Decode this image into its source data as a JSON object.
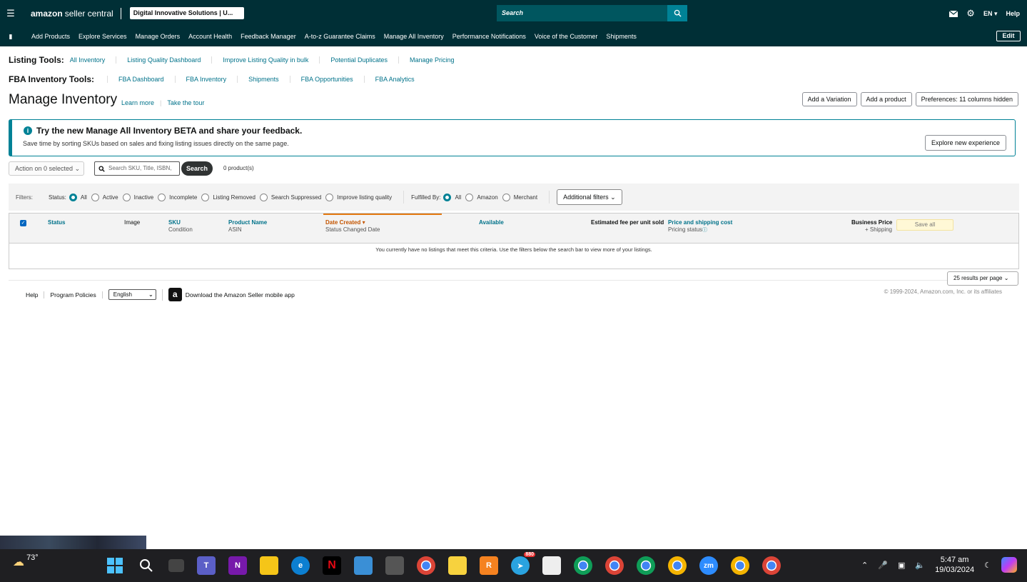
{
  "header": {
    "logo_text": "amazon",
    "logo_sub": "seller central",
    "account": "Digital Innovative Solutions | U...",
    "search_placeholder": "Search",
    "language": "EN",
    "help": "Help"
  },
  "nav": {
    "items": [
      "Add Products",
      "Explore Services",
      "Manage Orders",
      "Account Health",
      "Feedback Manager",
      "A-to-z Guarantee Claims",
      "Manage All Inventory",
      "Performance Notifications",
      "Voice of the Customer",
      "Shipments"
    ],
    "edit": "Edit"
  },
  "listing_tools": {
    "title": "Listing Tools:",
    "links": [
      "All Inventory",
      "Listing Quality Dashboard",
      "Improve Listing Quality in bulk",
      "Potential Duplicates",
      "Manage Pricing"
    ]
  },
  "fba_tools": {
    "title": "FBA Inventory Tools:",
    "links": [
      "FBA Dashboard",
      "FBA Inventory",
      "Shipments",
      "FBA Opportunities",
      "FBA Analytics"
    ]
  },
  "page": {
    "title": "Manage Inventory",
    "learn_more": "Learn more",
    "take_tour": "Take the tour",
    "add_variation": "Add a Variation",
    "add_product": "Add a product",
    "preferences": "Preferences: 11 columns hidden"
  },
  "banner": {
    "title": "Try the new Manage All Inventory BETA and share your feedback.",
    "body": "Save time by sorting SKUs based on sales and fixing listing issues directly on the same page.",
    "button": "Explore new experience"
  },
  "toolbar": {
    "action": "Action on 0 selected",
    "search_placeholder": "Search SKU, Title, ISBN,",
    "search_button": "Search",
    "count": "0 product(s)"
  },
  "filters": {
    "label": "Filters:",
    "status_label": "Status:",
    "status_options": [
      "All",
      "Active",
      "Inactive",
      "Incomplete",
      "Listing Removed",
      "Search Suppressed",
      "Improve listing quality"
    ],
    "fulfilled_label": "Fulfilled By:",
    "fulfilled_options": [
      "All",
      "Amazon",
      "Merchant"
    ],
    "additional": "Additional filters"
  },
  "table": {
    "col_status": "Status",
    "col_image": "Image",
    "col_sku": "SKU",
    "col_sku_sub": "Condition",
    "col_name": "Product Name",
    "col_name_sub": "ASIN",
    "col_date": "Date Created",
    "col_date_sub": "Status Changed Date",
    "col_available": "Available",
    "col_fee": "Estimated fee per unit sold",
    "col_price": "Price and shipping cost",
    "col_price_sub": "Pricing status",
    "col_business": "Business Price",
    "col_business_sub": "+ Shipping",
    "save_all": "Save all",
    "empty": "You currently have no listings that meet this criteria. Use the filters below the search bar to view more of your listings."
  },
  "pagination": {
    "per_page": "25 results per page"
  },
  "footer": {
    "help": "Help",
    "policies": "Program Policies",
    "language": "English",
    "app": "Download the Amazon Seller mobile app",
    "copyright": "© 1999-2024, Amazon.com, Inc. or its affiliates"
  },
  "taskbar": {
    "temp": "73°",
    "time": "5:47 am",
    "date": "19/03/2024",
    "badge": "880"
  }
}
